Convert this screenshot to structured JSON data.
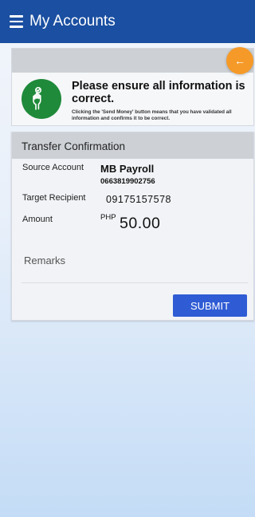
{
  "appbar": {
    "title": "My Accounts"
  },
  "notice": {
    "title": "Please ensure all information is correct.",
    "text": "Clicking the 'Send Money' button means that you have validated all information and confirms it to be correct."
  },
  "confirmation": {
    "header": "Transfer Confirmation",
    "source_label": "Source Account",
    "source_name": "MB Payroll",
    "source_number": "0663819902756",
    "target_label": "Target Recipient",
    "target_value": "09175157578",
    "amount_label": "Amount",
    "currency": "PHP",
    "amount": "50.00",
    "remarks_placeholder": "Remarks",
    "submit_label": "SUBMIT"
  },
  "colors": {
    "appbar": "#1a4fa1",
    "fab": "#f59a28",
    "submit": "#2f5cd4",
    "hand_icon_bg": "#1f8a3a"
  }
}
